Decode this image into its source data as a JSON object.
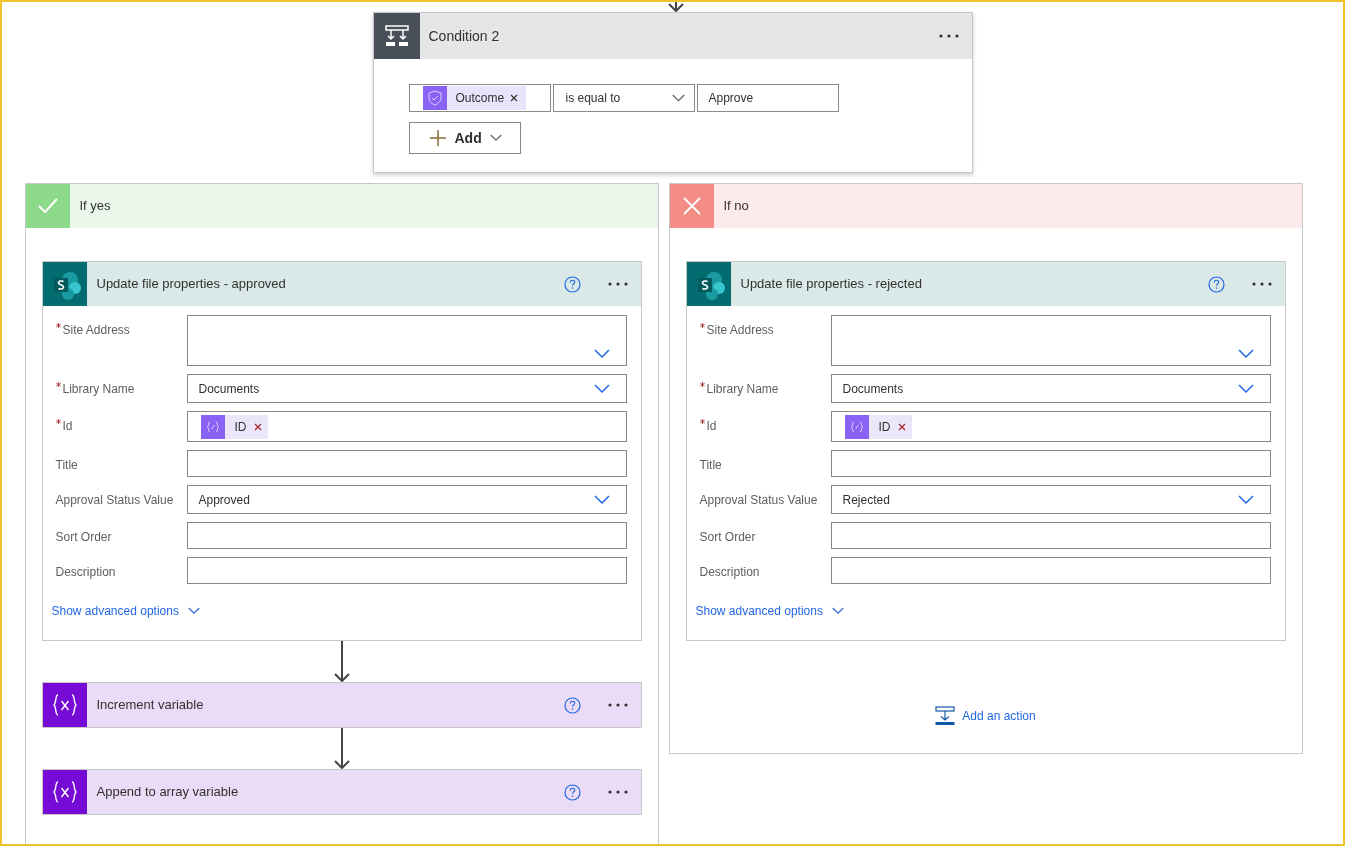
{
  "condition": {
    "title": "Condition 2",
    "token": "Outcome",
    "operator": "is equal to",
    "value": "Approve",
    "add_button": "Add"
  },
  "branches": [
    {
      "kind": "yes",
      "title": "If yes",
      "actions": [
        {
          "kind": "sharepoint",
          "title": "Update file properties - approved",
          "fields": [
            {
              "label": "Site Address",
              "required": true,
              "kind": "tall_dropdown"
            },
            {
              "label": "Library Name",
              "required": true,
              "kind": "dropdown",
              "value": "Documents"
            },
            {
              "label": "Id",
              "required": true,
              "kind": "token",
              "token": "ID"
            },
            {
              "label": "Title",
              "required": false,
              "kind": "text"
            },
            {
              "label": "Approval Status Value",
              "required": false,
              "kind": "dropdown",
              "value": "Approved"
            },
            {
              "label": "Sort Order",
              "required": false,
              "kind": "text"
            },
            {
              "label": "Description",
              "required": false,
              "kind": "text"
            }
          ],
          "advanced_link": "Show advanced options"
        },
        {
          "kind": "variable",
          "title": "Increment variable"
        },
        {
          "kind": "variable",
          "title": "Append to array variable"
        }
      ]
    },
    {
      "kind": "no",
      "title": "If no",
      "actions": [
        {
          "kind": "sharepoint",
          "title": "Update file properties - rejected",
          "fields": [
            {
              "label": "Site Address",
              "required": true,
              "kind": "tall_dropdown"
            },
            {
              "label": "Library Name",
              "required": true,
              "kind": "dropdown",
              "value": "Documents"
            },
            {
              "label": "Id",
              "required": true,
              "kind": "token",
              "token": "ID"
            },
            {
              "label": "Title",
              "required": false,
              "kind": "text"
            },
            {
              "label": "Approval Status Value",
              "required": false,
              "kind": "dropdown",
              "value": "Rejected"
            },
            {
              "label": "Sort Order",
              "required": false,
              "kind": "text"
            },
            {
              "label": "Description",
              "required": false,
              "kind": "text"
            }
          ],
          "advanced_link": "Show advanced options"
        }
      ],
      "add_action": "Add an action"
    }
  ]
}
